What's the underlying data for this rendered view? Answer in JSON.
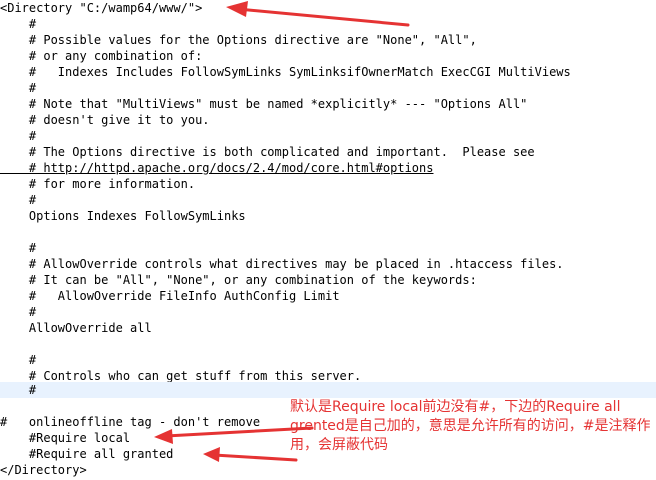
{
  "code": {
    "lines": [
      "<Directory \"C:/wamp64/www/\">",
      "    #",
      "    # Possible values for the Options directive are \"None\", \"All\",",
      "    # or any combination of:",
      "    #   Indexes Includes FollowSymLinks SymLinksifOwnerMatch ExecCGI MultiViews",
      "    #",
      "    # Note that \"MultiViews\" must be named *explicitly* --- \"Options All\"",
      "    # doesn't give it to you.",
      "    #",
      "    # The Options directive is both complicated and important.  Please see",
      "    # http://httpd.apache.org/docs/2.4/mod/core.html#options",
      "    # for more information.",
      "    #",
      "    Options Indexes FollowSymLinks",
      "",
      "    #",
      "    # AllowOverride controls what directives may be placed in .htaccess files.",
      "    # It can be \"All\", \"None\", or any combination of the keywords:",
      "    #   AllowOverride FileInfo AuthConfig Limit",
      "    #",
      "    AllowOverride all",
      "",
      "    #",
      "    # Controls who can get stuff from this server.",
      "    #",
      "",
      "#   onlineoffline tag - don't remove",
      "    #Require local",
      "    #Require all granted",
      "</Directory>"
    ],
    "highlighted_line": 24,
    "link_line": 10
  },
  "annotation": {
    "text": "默认是Require local前边没有#，下边的Require all grented是自己加的，意思是允许所有的访问，#是注释作用，会屏蔽代码",
    "color": "#e53333"
  },
  "arrows": {
    "color": "#e53333"
  }
}
